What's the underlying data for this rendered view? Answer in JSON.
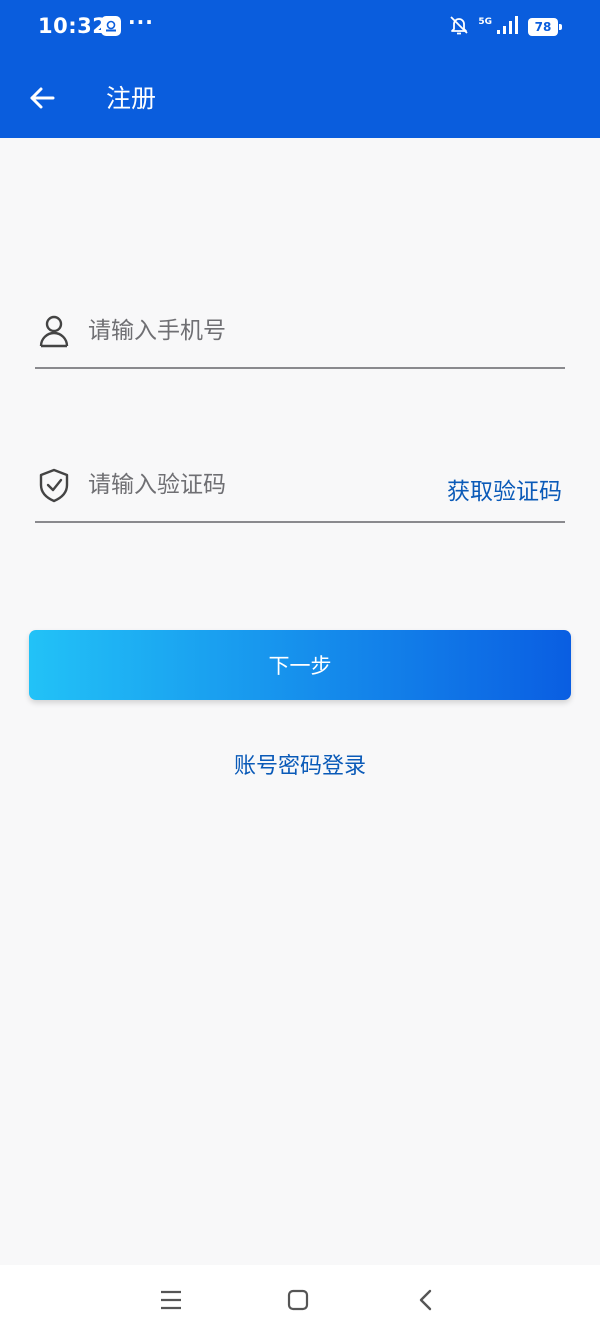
{
  "status_bar": {
    "time": "10:32",
    "overflow": "···",
    "network": "5G",
    "battery": "78"
  },
  "header": {
    "title": "注册",
    "back_icon": "arrow-left-icon"
  },
  "form": {
    "phone_placeholder": "请输入手机号",
    "phone_icon": "user-icon",
    "code_placeholder": "请输入验证码",
    "code_icon": "shield-check-icon",
    "get_code_label": "获取验证码"
  },
  "actions": {
    "next_label": "下一步",
    "account_login_label": "账号密码登录"
  },
  "nav": {
    "icons": [
      "menu-icon",
      "home-icon",
      "back-chevron-icon"
    ]
  },
  "colors": {
    "primary": "#0a5ddd",
    "link": "#0a5ab8",
    "button_gradient_start": "#22c2f7",
    "button_gradient_end": "#0a5ee2",
    "background": "#f8f8f9"
  }
}
